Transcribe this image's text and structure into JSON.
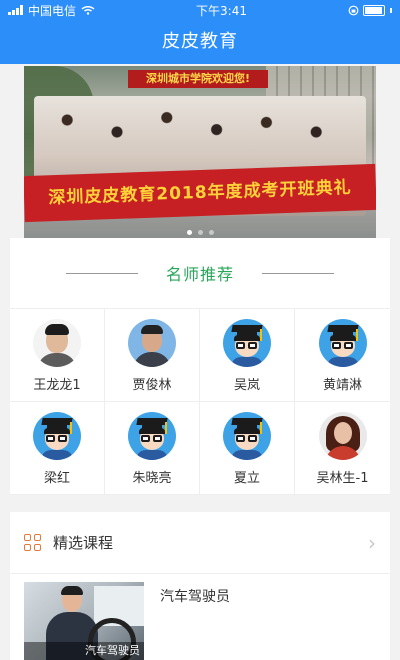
{
  "status_bar": {
    "carrier": "中国电信",
    "time": "下午3:41"
  },
  "header": {
    "title": "皮皮教育"
  },
  "banner": {
    "sign_text": "深圳城市学院欢迎您!",
    "banner_text": "深圳皮皮教育2018年度成考开班典礼"
  },
  "teachers": {
    "section_title": "名师推荐",
    "items": [
      {
        "name": "王龙龙1",
        "avatar": "photo-man"
      },
      {
        "name": "贾俊林",
        "avatar": "photo-blue"
      },
      {
        "name": "吴岚",
        "avatar": "cartoon-graduate"
      },
      {
        "name": "黄靖淋",
        "avatar": "cartoon-graduate"
      },
      {
        "name": "梁红",
        "avatar": "cartoon-graduate"
      },
      {
        "name": "朱晓亮",
        "avatar": "cartoon-graduate"
      },
      {
        "name": "夏立",
        "avatar": "cartoon-graduate"
      },
      {
        "name": "吴林生-1",
        "avatar": "photo-woman"
      }
    ]
  },
  "courses": {
    "section_title": "精选课程",
    "items": [
      {
        "title": "汽车驾驶员",
        "thumb_caption": "汽车驾驶员"
      }
    ]
  },
  "colors": {
    "header_bg": "#2c8ef8",
    "teacher_title": "#2aa55a",
    "course_icon": "#e07a3c"
  }
}
